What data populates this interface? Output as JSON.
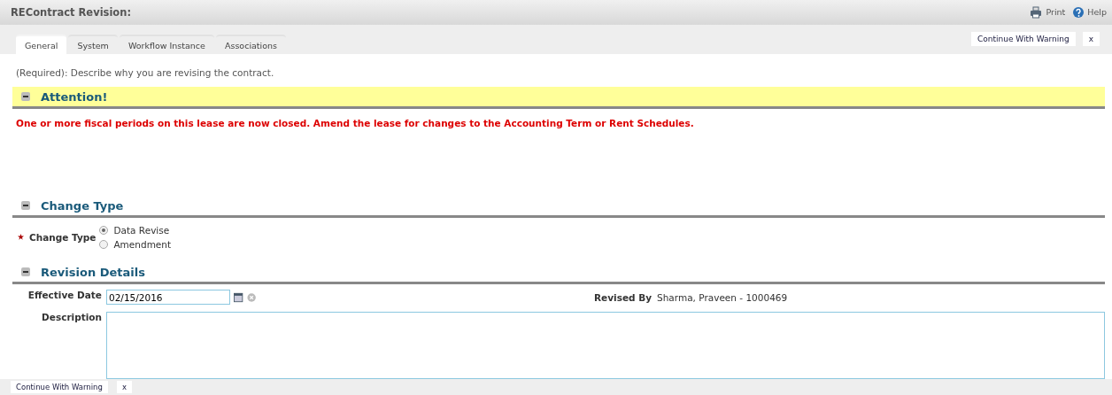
{
  "window": {
    "title": "REContract Revision:",
    "actions": [
      {
        "kind": "print",
        "label": "Print"
      },
      {
        "kind": "help",
        "label": "Help"
      }
    ]
  },
  "tabs": [
    {
      "label": "General",
      "selected": true
    },
    {
      "label": "System",
      "selected": false
    },
    {
      "label": "Workflow Instance",
      "selected": false
    },
    {
      "label": "Associations",
      "selected": false
    }
  ],
  "top_buttons": [
    "Continue With Warning",
    "x"
  ],
  "instruction": "(Required): Describe why you are revising the contract.",
  "attention": {
    "title": "Attention!",
    "expanded": true,
    "message": "One or more fiscal periods on this lease are now closed. Amend the lease for changes to the Accounting Term or Rent Schedules."
  },
  "change_type_section": {
    "title": "Change Type",
    "expanded": true,
    "field_label": "Change Type",
    "required": true,
    "options": [
      {
        "label": "Data Revise",
        "selected": true
      },
      {
        "label": "Amendment",
        "selected": false
      }
    ]
  },
  "revision_details": {
    "title": "Revision Details",
    "expanded": true,
    "effective_date_label": "Effective Date",
    "effective_date": "02/15/2016",
    "revised_by_label": "Revised By",
    "revised_by": "Sharma, Praveen - 1000469",
    "description_label": "Description"
  },
  "bottom_buttons": [
    "Continue With Warning",
    "x"
  ]
}
